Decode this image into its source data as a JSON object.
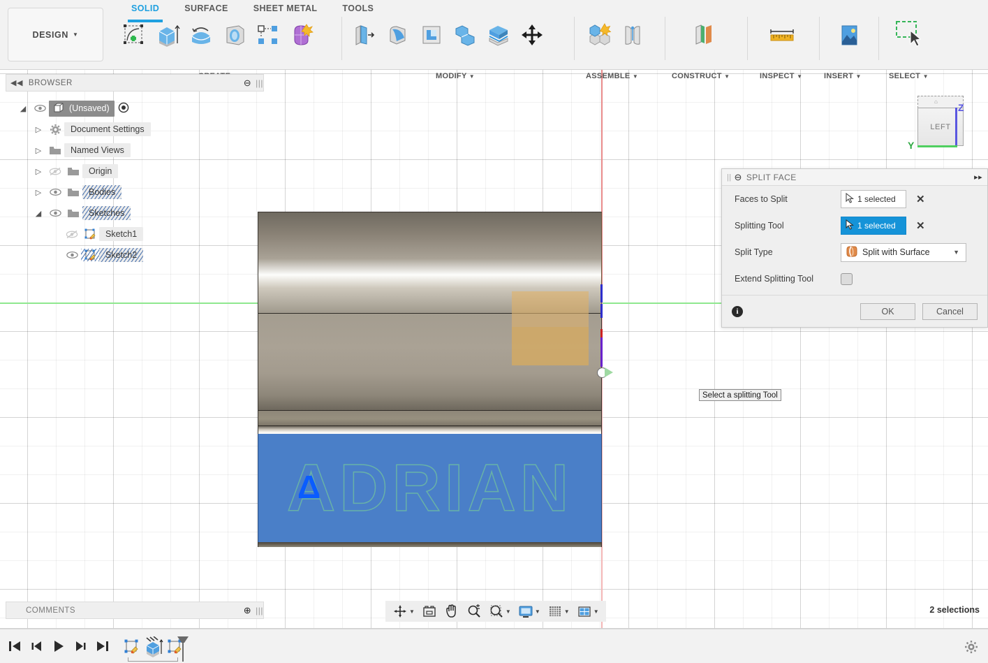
{
  "app": {
    "workspace": "DESIGN",
    "tabs": [
      {
        "label": "SOLID",
        "active": true
      },
      {
        "label": "SURFACE",
        "active": false
      },
      {
        "label": "SHEET METAL",
        "active": false
      },
      {
        "label": "TOOLS",
        "active": false
      }
    ],
    "ribbon_groups": [
      {
        "label": "CREATE",
        "icons": [
          "create-sketch-icon",
          "extrude-icon",
          "revolve-icon",
          "sweep-icon",
          "pattern-icon",
          "form-icon"
        ]
      },
      {
        "label": "MODIFY",
        "icons": [
          "press-pull-icon",
          "fillet-icon",
          "shell-icon",
          "combine-icon",
          "split-face-icon",
          "move-copy-icon"
        ]
      },
      {
        "label": "ASSEMBLE",
        "icons": [
          "new-component-icon",
          "joint-icon"
        ]
      },
      {
        "label": "CONSTRUCT",
        "icons": [
          "offset-plane-icon"
        ]
      },
      {
        "label": "INSPECT",
        "icons": [
          "measure-icon"
        ]
      },
      {
        "label": "INSERT",
        "icons": [
          "insert-image-icon"
        ]
      },
      {
        "label": "SELECT",
        "icons": [
          "window-select-icon"
        ]
      }
    ]
  },
  "browser": {
    "title": "BROWSER",
    "collapse_icon": "collapse-left-icon",
    "minus_icon": "minus-circle-icon",
    "tree": [
      {
        "label": "(Unsaved)",
        "indent": 0,
        "twisty": "expanded",
        "eye": "visible",
        "icon": "component-icon",
        "selected": true,
        "radio": true
      },
      {
        "label": "Document Settings",
        "indent": 1,
        "twisty": "collapsed",
        "eye": "none",
        "icon": "gear-icon",
        "selected": false
      },
      {
        "label": "Named Views",
        "indent": 1,
        "twisty": "collapsed",
        "eye": "none",
        "icon": "folder-icon",
        "selected": false
      },
      {
        "label": "Origin",
        "indent": 1,
        "twisty": "collapsed",
        "eye": "hidden",
        "icon": "folder-icon",
        "selected": false
      },
      {
        "label": "Bodies",
        "indent": 1,
        "twisty": "collapsed",
        "eye": "visible",
        "icon": "folder-icon",
        "selected": false
      },
      {
        "label": "Sketches",
        "indent": 1,
        "twisty": "expanded",
        "eye": "visible",
        "icon": "folder-icon",
        "selected": false
      },
      {
        "label": "Sketch1",
        "indent": 2,
        "twisty": "none",
        "eye": "hidden",
        "icon": "sketch-icon",
        "selected": false
      },
      {
        "label": "Sketch2",
        "indent": 2,
        "twisty": "none",
        "eye": "visible",
        "icon": "sketch-icon",
        "selected": false
      }
    ]
  },
  "dialog": {
    "title": "SPLIT FACE",
    "title_icon": "minus-circle-icon",
    "expand_icon": "expand-right-icon",
    "rows": [
      {
        "label": "Faces to Split",
        "value": "1 selected",
        "icon": "cursor-arrow-icon",
        "active": false,
        "clear_icon": "clear-x-icon"
      },
      {
        "label": "Splitting Tool",
        "value": "1 selected",
        "icon": "cursor-arrow-icon",
        "active": true,
        "clear_icon": "clear-x-icon"
      }
    ],
    "split_type": {
      "label": "Split Type",
      "value": "Split with Surface",
      "icon": "split-surface-icon"
    },
    "extend": {
      "label": "Extend Splitting Tool",
      "checked": false
    },
    "info_icon": "info-icon",
    "ok_label": "OK",
    "cancel_label": "Cancel"
  },
  "tooltip": {
    "text": "Select a splitting Tool"
  },
  "viewcube": {
    "face_label": "LEFT",
    "z_label": "Z",
    "y_label": "Y",
    "z_color": "#5a57e0",
    "y_color": "#2fa843"
  },
  "model": {
    "engraved_text": "ADRIAN",
    "delta_mark": "Δ",
    "label_color": "#4a7fc8",
    "engrave_stroke_color": "#78cd96",
    "highlight_color": "#d6aa60",
    "delta_color": "#0a5cff"
  },
  "statusbar": {
    "comments_label": "COMMENTS",
    "comments_add_icon": "add-circle-icon",
    "selection_count": "2 selections",
    "nav_icons": [
      "orbit-icon",
      "look-at-icon",
      "pan-icon",
      "zoom-icon",
      "zoom-window-icon",
      "display-settings-icon",
      "grid-snap-icon",
      "viewports-icon"
    ]
  },
  "timeline": {
    "controls": [
      "go-to-beginning-icon",
      "step-back-icon",
      "play-icon",
      "step-forward-icon",
      "go-to-end-icon"
    ],
    "features": [
      "sketch1-feature-icon",
      "extrude-feature-icon",
      "sketch2-feature-icon"
    ],
    "settings_icon": "gear-icon"
  }
}
